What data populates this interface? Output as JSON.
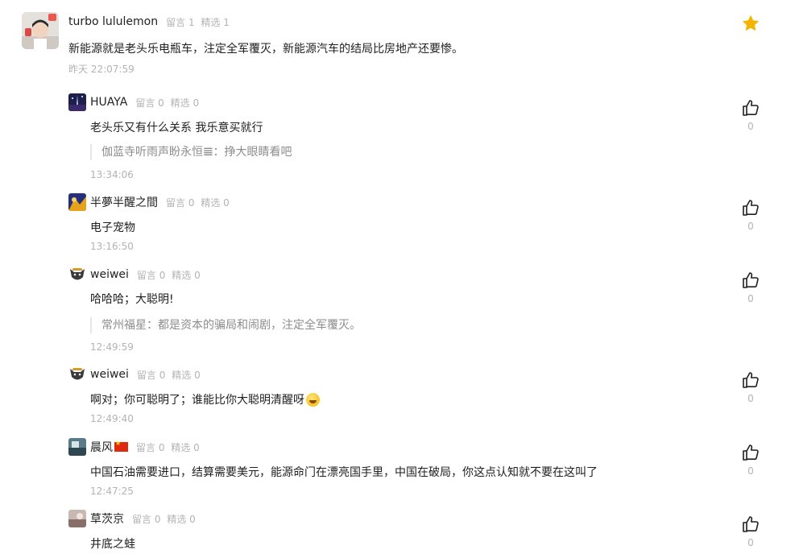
{
  "main_comment": {
    "author": "turbo lululemon",
    "meta_label_replies": "留言",
    "replies_count": "1",
    "meta_label_featured": "精选",
    "featured_count": "1",
    "text": "新能源就是老头乐电瓶车，注定全军覆灭，新能源汽车的结局比房地产还要惨。",
    "time": "昨天 22:07:59",
    "star_icon": "star-icon",
    "star_color": "#f5b400"
  },
  "replies": [
    {
      "author": "HUAYA",
      "meta_label_replies": "留言",
      "replies_count": "0",
      "meta_label_featured": "精选",
      "featured_count": "0",
      "text": "老头乐又有什么关系 我乐意买就行",
      "quote": "伽蓝寺听雨声盼永恒𝌆：挣大眼睛看吧",
      "time": "13:34:06",
      "likes": "0"
    },
    {
      "author": "半夢半醒之間",
      "meta_label_replies": "留言",
      "replies_count": "0",
      "meta_label_featured": "精选",
      "featured_count": "0",
      "text": "电子宠物",
      "time": "13:16:50",
      "likes": "0"
    },
    {
      "author": "weiwei",
      "meta_label_replies": "留言",
      "replies_count": "0",
      "meta_label_featured": "精选",
      "featured_count": "0",
      "text": "哈哈哈；大聪明!",
      "quote": "常州福星：都是资本的骗局和闹剧，注定全军覆灭。",
      "time": "12:49:59",
      "likes": "0"
    },
    {
      "author": "weiwei",
      "meta_label_replies": "留言",
      "replies_count": "0",
      "meta_label_featured": "精选",
      "featured_count": "0",
      "text": "啊对；你可聪明了；谁能比你大聪明清醒呀",
      "time": "12:49:40",
      "likes": "0"
    },
    {
      "author": "晨风",
      "meta_label_replies": "留言",
      "replies_count": "0",
      "meta_label_featured": "精选",
      "featured_count": "0",
      "text": "中国石油需要进口，结算需要美元，能源命门在漂亮国手里，中国在破局，你这点认知就不要在这叫了",
      "time": "12:47:25",
      "likes": "0"
    },
    {
      "author": "草茨京",
      "meta_label_replies": "留言",
      "replies_count": "0",
      "meta_label_featured": "精选",
      "featured_count": "0",
      "text": "井底之蛙",
      "likes": "0"
    }
  ]
}
